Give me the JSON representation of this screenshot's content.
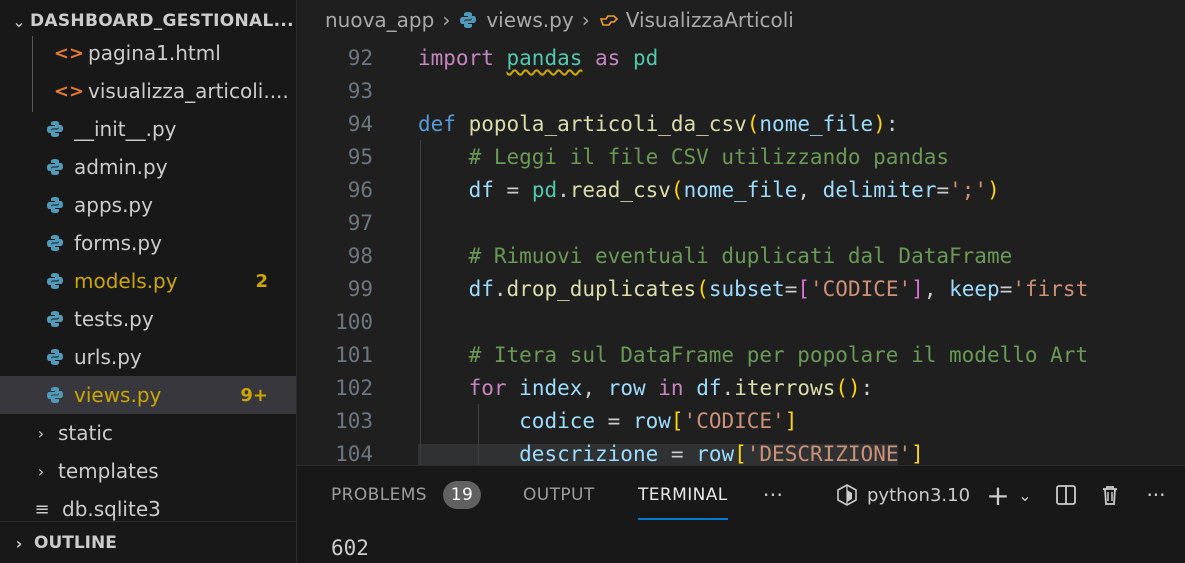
{
  "explorer": {
    "project_title": "DASHBOARD_GESTIONAL...",
    "items": [
      {
        "label": "pagina1.html",
        "type": "html",
        "badge": ""
      },
      {
        "label": "visualizza_articoli....",
        "type": "html",
        "badge": ""
      },
      {
        "label": "__init__.py",
        "type": "python",
        "badge": ""
      },
      {
        "label": "admin.py",
        "type": "python",
        "badge": ""
      },
      {
        "label": "apps.py",
        "type": "python",
        "badge": ""
      },
      {
        "label": "forms.py",
        "type": "python",
        "badge": ""
      },
      {
        "label": "models.py",
        "type": "python",
        "badge": "2"
      },
      {
        "label": "tests.py",
        "type": "python",
        "badge": ""
      },
      {
        "label": "urls.py",
        "type": "python",
        "badge": ""
      },
      {
        "label": "views.py",
        "type": "python",
        "badge": "9+"
      },
      {
        "label": "static",
        "type": "folder",
        "badge": ""
      },
      {
        "label": "templates",
        "type": "folder",
        "badge": ""
      },
      {
        "label": "db.sqlite3",
        "type": "db",
        "badge": ""
      }
    ],
    "outline_label": "OUTLINE"
  },
  "breadcrumb": {
    "folder": "nuova_app",
    "file": "views.py",
    "symbol": "VisualizzaArticoli"
  },
  "editor": {
    "line_numbers": [
      "92",
      "93",
      "94",
      "95",
      "96",
      "97",
      "98",
      "99",
      "100",
      "101",
      "102",
      "103",
      "104"
    ],
    "line_texts": {
      "l92": "import pandas as pd",
      "l94": "def popola_articoli_da_csv(nome_file):",
      "l95": "    # Leggi il file CSV utilizzando pandas",
      "l96": "    df = pd.read_csv(nome_file, delimiter=';')",
      "l98": "    # Rimuovi eventuali duplicati dal DataFrame",
      "l99": "    df.drop_duplicates(subset=['CODICE'], keep='first",
      "l101": "    # Itera sul DataFrame per popolare il modello Art",
      "l102": "    for index, row in df.iterrows():",
      "l103": "        codice = row['CODICE']",
      "l104": "        descrizione = row['DESCRIZIONE']"
    }
  },
  "panel": {
    "tabs": {
      "problems": "PROBLEMS",
      "problems_count": "19",
      "output": "OUTPUT",
      "terminal": "TERMINAL",
      "more": "···"
    },
    "terminal_profile": "python3.10",
    "terminal_output": "602",
    "active_tab": "TERMINAL"
  },
  "colors": {
    "accent": "#0078d4",
    "modified": "#cca700",
    "python_icon": "#519aba",
    "html_icon": "#e37933"
  }
}
